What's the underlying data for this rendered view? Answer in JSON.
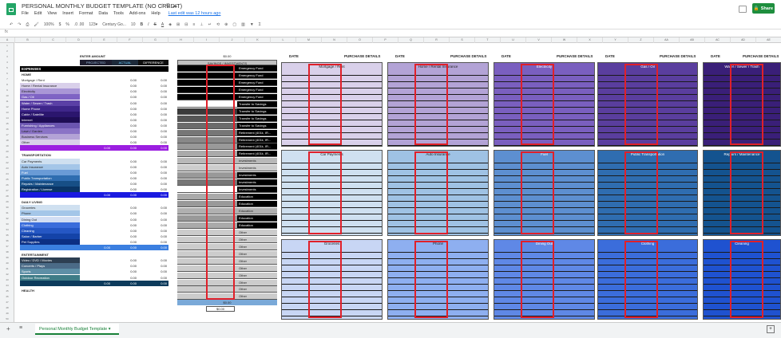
{
  "header": {
    "doc_title": "PERSONAL MONTHLY BUDGET TEMPLATE (NO CREDIT)",
    "menus": [
      "File",
      "Edit",
      "View",
      "Insert",
      "Format",
      "Data",
      "Tools",
      "Add-ons",
      "Help"
    ],
    "last_edit": "Last edit was 12 hours ago",
    "share_label": "Share"
  },
  "toolbar": {
    "zoom": "100%",
    "currency": "$",
    "percent": "%",
    "decimals": ".0  .00",
    "format": "123▾",
    "font": "Century Go...",
    "font_size": "10"
  },
  "columns": [
    "A",
    "B",
    "C",
    "D",
    "E",
    "F",
    "G",
    "H",
    "I",
    "J",
    "K",
    "L",
    "M",
    "N",
    "O",
    "P",
    "Q",
    "R",
    "S",
    "T",
    "U",
    "V",
    "W",
    "X",
    "Y",
    "Z",
    "AA",
    "AB",
    "AC",
    "AD",
    "AE"
  ],
  "budget": {
    "enter_amount": "ENTER AMOUNT",
    "col_projected": "PROJECTED",
    "col_actual": "ACTUAL",
    "col_difference": "DIFFERENCE",
    "expenses": "EXPENSES",
    "home": "HOME",
    "home_items": [
      "Mortgage / Rent",
      "Home / Rental Insurance",
      "Electricity",
      "Gas / Oil",
      "Water / Sewer / Trash",
      "Home Phone",
      "Cable / Satellite",
      "Internet",
      "Furnishing / Appliances",
      "Lawn / Garden",
      "Business Services",
      "Other"
    ],
    "transportation": "TRANSPORTATION",
    "transport_items": [
      "Car Payments",
      "Auto Insurance",
      "Fuel",
      "Public Transportation",
      "Repairs / Maintenance",
      "Registration / License"
    ],
    "daily_living": "DAILY LIVING",
    "daily_items": [
      "Groceries",
      "Phone",
      "Dining Out",
      "Clothing",
      "Cleaning",
      "Salon / Barber",
      "Pet Supplies"
    ],
    "entertainment": "ENTERTAINMENT",
    "entertainment_items": [
      "Video / DVD / Movies",
      "Concerts / Plays",
      "Sports",
      "Outdoor Recreation"
    ],
    "health": "HEALTH",
    "zero": "0.00"
  },
  "savings": {
    "header": "SAVINGS / INVESTMENTS",
    "total_top": "$0.00",
    "labels": [
      "Emergency Fund",
      "Emergency Fund",
      "Emergency Fund",
      "Emergency Fund",
      "Emergency Fund",
      "Transfer to Savings",
      "Transfer to Savings",
      "Transfer to Savings",
      "Transfer to Savings",
      "Retirement (401k, IR...",
      "Retirement (401k, IR...",
      "Retirement (401k, IR...",
      "Retirement (401k, IR...",
      "Investments",
      "Investments",
      "Investments",
      "Investments",
      "Investments",
      "Education",
      "Education",
      "Education",
      "Education",
      "Education",
      "Other",
      "Other",
      "Other",
      "Other",
      "Other",
      "Other",
      "Other",
      "Other",
      "Other",
      "Other"
    ],
    "total_bottom_1": "$0.00",
    "total_bottom_2": "$0.00"
  },
  "panels_header": {
    "date": "DATE",
    "purchase_details": "PURCHASE DETAILS"
  },
  "panel_titles": {
    "row1": [
      "Mortgage / Rent",
      "Home / Rental Insurance",
      "Electricity",
      "Gas / Oil",
      "Water / Sewer / Trash"
    ],
    "row2": [
      "Car Payments",
      "Auto Insurance",
      "Fuel",
      "Public Transportation",
      "Repairs / Maintenance"
    ],
    "row3": [
      "Groceries",
      "Phone",
      "Dining Out",
      "Clothing",
      "Cleaning"
    ]
  },
  "colors": {
    "row1": [
      "#d9d0ea",
      "#b3a3d6",
      "#7a5fbf",
      "#5a3e9e",
      "#3a1f78"
    ],
    "row2": [
      "#cfe0f0",
      "#9fc2e4",
      "#5d8fd0",
      "#2f6db0",
      "#14538f"
    ],
    "row3": [
      "#c8d6f4",
      "#8eaff0",
      "#5f88e6",
      "#3b6ddb",
      "#1f52d0"
    ],
    "highlight": "#e0202a",
    "accent": "#23a566"
  },
  "sheet_tab": "Personal Monthly Budget Template"
}
